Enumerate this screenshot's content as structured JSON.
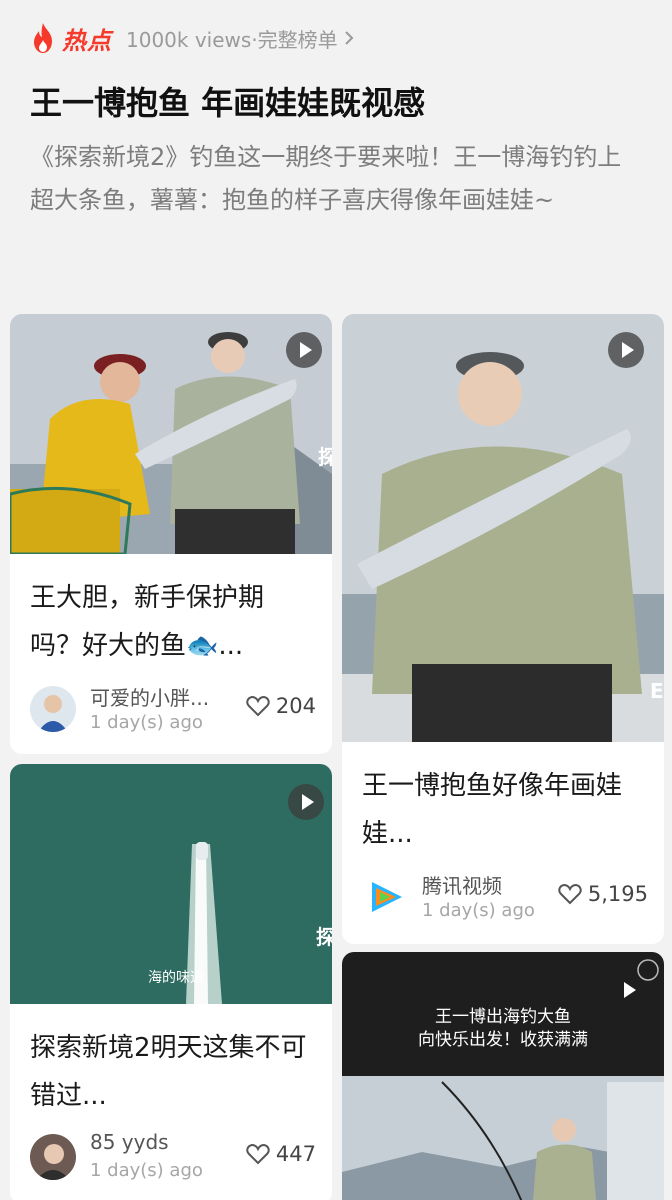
{
  "header": {
    "hot_label": "热点",
    "views_link": "1000k views·完整榜单",
    "chevron": "›"
  },
  "topic": {
    "title": "王一博抱鱼 年画娃娃既视感",
    "description": "《探索新境2》钓鱼这一期终于要来啦！王一博海钓钓上超大条鱼，薯薯：抱鱼的样子喜庆得像年画娃娃~"
  },
  "cards": [
    {
      "title": "王大胆，新手保护期吗？好大的鱼🐟...",
      "author": "可爱的小胖...",
      "time": "1 day(s) ago",
      "likes": "204",
      "overlay_text": "探新"
    },
    {
      "title": "王一博抱鱼好像年画娃娃...",
      "author": "腾讯视频",
      "time": "1 day(s) ago",
      "likes": "5,195",
      "overlay_text": "E"
    },
    {
      "title": "探索新境2明天这集不可错过...",
      "author": "85 yyds",
      "time": "1 day(s) ago",
      "likes": "447",
      "overlay_text": "海的味道",
      "side_text": "探新"
    },
    {
      "caption_line1": "王一博出海钓大鱼",
      "caption_line2": "向快乐出发！收获满满"
    }
  ],
  "icons": {
    "flame": "flame-icon",
    "play": "play-icon",
    "heart": "heart-outline-icon",
    "chevron": "chevron-right-icon"
  },
  "colors": {
    "accent": "#f5392b",
    "background": "#f2f2f2",
    "muted_text": "#9a9a9a"
  }
}
